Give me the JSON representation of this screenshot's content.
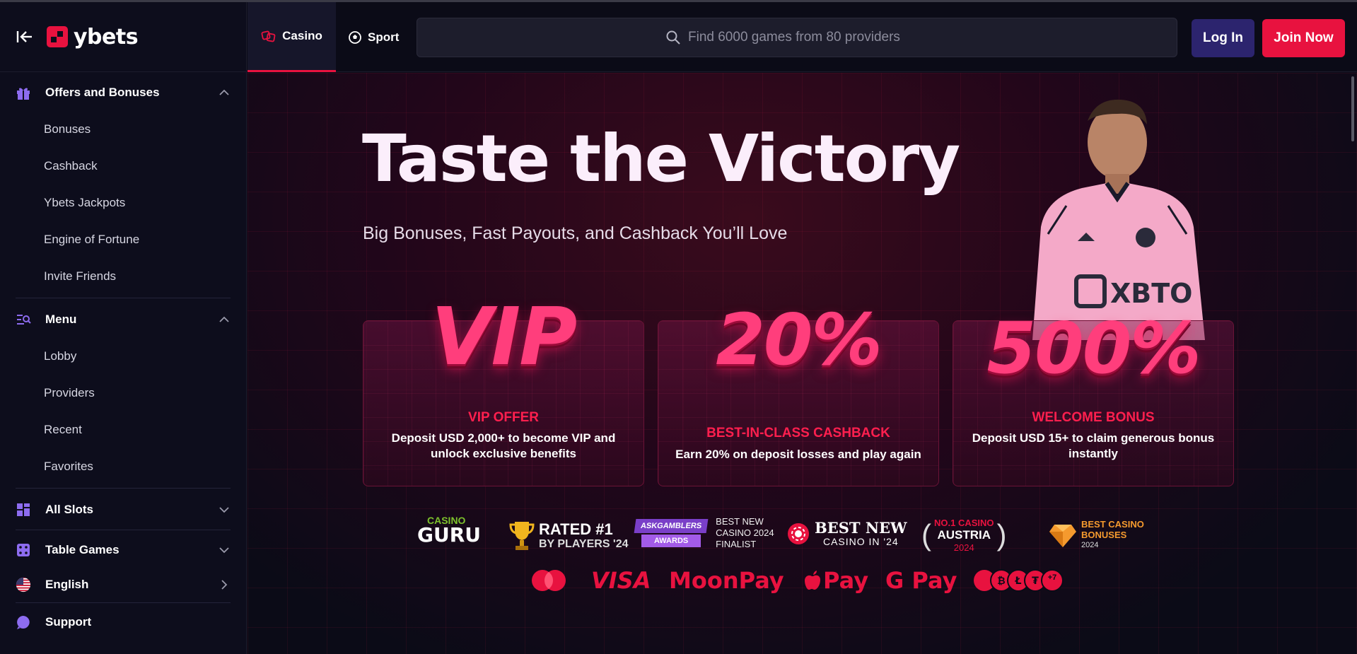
{
  "brand": {
    "name": "ybets"
  },
  "sidebar": {
    "sections": [
      {
        "label": "Offers and Bonuses",
        "items": [
          "Bonuses",
          "Cashback",
          "Ybets Jackpots",
          "Engine of Fortune",
          "Invite Friends"
        ]
      },
      {
        "label": "Menu",
        "items": [
          "Lobby",
          "Providers",
          "Recent",
          "Favorites"
        ]
      }
    ],
    "all_slots": "All Slots",
    "table_games": "Table Games",
    "language": "English",
    "support": "Support"
  },
  "topbar": {
    "tabs": [
      {
        "label": "Casino",
        "active": true
      },
      {
        "label": "Sport",
        "active": false
      }
    ],
    "search_placeholder": "Find 6000 games from 80 providers",
    "login_label": "Log In",
    "join_label": "Join Now"
  },
  "hero": {
    "title": "Taste the Victory",
    "subtitle": "Big Bonuses, Fast Payouts, and Cashback You’ll Love"
  },
  "cards": [
    {
      "big": "VIP",
      "label": "VIP OFFER",
      "desc": "Deposit USD 2,000+ to become VIP and unlock exclusive benefits"
    },
    {
      "big": "20%",
      "label": "BEST-IN-CLASS CASHBACK",
      "desc": "Earn 20% on deposit losses and play again"
    },
    {
      "big": "500%",
      "label": "WELCOME BONUS",
      "desc": "Deposit USD 15+ to claim generous bonus instantly"
    }
  ],
  "awards": {
    "casino_guru": {
      "top": "CASINO",
      "bottom": "GURU"
    },
    "rated": {
      "line1": "RATED #1",
      "line2": "BY PLAYERS '24"
    },
    "askgamblers": {
      "badge1": "ASKGAMBLERS",
      "badge2": "AWARDS",
      "text1": "BEST NEW",
      "text2": "CASINO 2024",
      "text3": "FINALIST"
    },
    "best_new": {
      "line1": "BEST NEW",
      "line2": "CASINO IN '24"
    },
    "austria": {
      "line1": "NO.1 CASINO",
      "line2": "AUSTRIA",
      "line3": "2024"
    },
    "bonuses": {
      "line1": "BEST CASINO",
      "line2": "BONUSES",
      "line3": "2024"
    }
  },
  "payments": {
    "visa": "VISA",
    "moonpay": "MoonPay",
    "applepay": "Pay",
    "gpay": "G Pay",
    "crypto_more": "+7"
  },
  "colors": {
    "accent": "#e8123f",
    "login": "#2c246e",
    "bg": "#0b0b17",
    "sidebar": "#0d0d1c"
  }
}
